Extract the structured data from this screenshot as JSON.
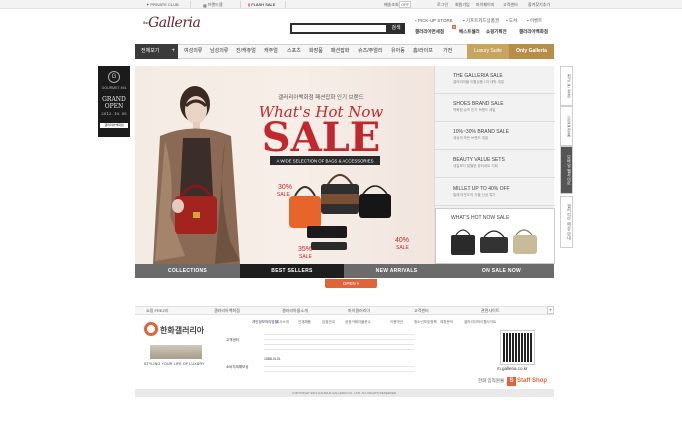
{
  "colors": {
    "accent_orange": "#e0643a",
    "gold_luxury": "#c8a55e",
    "gold_only": "#b78e48",
    "sale_red": "#c2272d",
    "dark": "#2d2d2d"
  },
  "topbar": {
    "private_club": "PRIVATE CLUB",
    "brand_list": "브랜드맵",
    "flash_sale": "FLASH SALE",
    "right_links": [
      "배송조회",
      "OFF",
      "로그인",
      "회원가입",
      "마이페이지",
      "고객센터",
      "즐겨찾기추가"
    ]
  },
  "header": {
    "logo_small": "the",
    "logo": "Galleria",
    "search_button": "검색",
    "pickup_store": "PICK-UP STORE",
    "gift_card": "기프트카드상품권",
    "shop": "도서",
    "event": "이벤트",
    "mall_name": "갤러리아면세점",
    "best": "베스트셀러",
    "plan": "쇼핑기획전",
    "galleria_store": "갤러리아백화점"
  },
  "nav": {
    "all_label": "전체보기",
    "items": [
      "여성의류",
      "남성의류",
      "진/캐쥬얼",
      "캐주얼",
      "스포츠",
      "화장품",
      "패션잡화",
      "슈즈/주얼리",
      "유아동",
      "홈/라이프",
      "가전"
    ],
    "luxury_suite": "Luxury Suite",
    "only_galleria": "Only Galleria"
  },
  "left_ad": {
    "circle": "G",
    "brand": "GOURMET 494",
    "line1": "GRAND",
    "line2": "OPEN",
    "date": "2012. 10. 05",
    "tag": "갤러리아백화점"
  },
  "hero": {
    "kicker": "갤러리아백화점 패션잡화 인기 브랜드",
    "title": "What's Hot Now",
    "big": "SALE",
    "ribbon": "A WIDE SELECTION OF BAGS & ACCESSORIES",
    "pct30": "30%",
    "pct35": "35%",
    "pct40": "40%",
    "sale_word": "SALE",
    "side_items": [
      {
        "title": "THE GALLERIA SALE",
        "sub": "갤러리아몰 이월상품 1차 대박 세일"
      },
      {
        "title": "SHOES BRAND SALE",
        "sub": "백화점 슈즈 인기 브랜드 세일"
      },
      {
        "title": "10%~30% BRAND SALE",
        "sub": "세상의 모든 브랜드 세일"
      },
      {
        "title": "BEAUTY VALUE SETS",
        "sub": "세일보다 알뜰한 뷰티세트 기회"
      },
      {
        "title": "MILLET UP TO 40% OFF",
        "sub": "밀레 아웃도어 가을 신상 특가"
      }
    ],
    "hot_title": "WHAT'S HOT NOW SALE",
    "tabs": [
      "COLLECTIONS",
      "BEST SELLERS",
      "NEW ARRIVALS",
      "ON SALE NOW"
    ],
    "open_button": "OPEN"
  },
  "quick": [
    "최근 본 상품",
    "오늘본상품",
    "모바일 웹사이트",
    "갤러리아 매장 안내"
  ],
  "footer": {
    "links": [
      "쇼핑 FREZ리",
      "갤러리아백화점",
      "갤러리아몰소개",
      "마이갤러리아",
      "고객센터",
      "관련사이트"
    ],
    "sub_links": [
      "개인정보처리방침",
      "회사소개",
      "인재채용",
      "입점안내",
      "공정거래자율준수",
      "이용약관",
      "청소년보호정책",
      "제휴문의",
      "갤러리아하이웹사이트"
    ],
    "company": "한화갤러리아",
    "tagline": "STYLING YOUR LIFE OF LUXURY",
    "customer_center": "고객센터",
    "escrow": "소비자피해보상",
    "phone": "1588-0121",
    "mobile": "m.galleria.co.kr",
    "partner": "한화 임직원몰",
    "staff_shop": "Staff Shop",
    "copyright": "COPYRIGHT 2013 HANWHA GALLERIA CO., LTD. ALL RIGHTS RESERVED."
  }
}
